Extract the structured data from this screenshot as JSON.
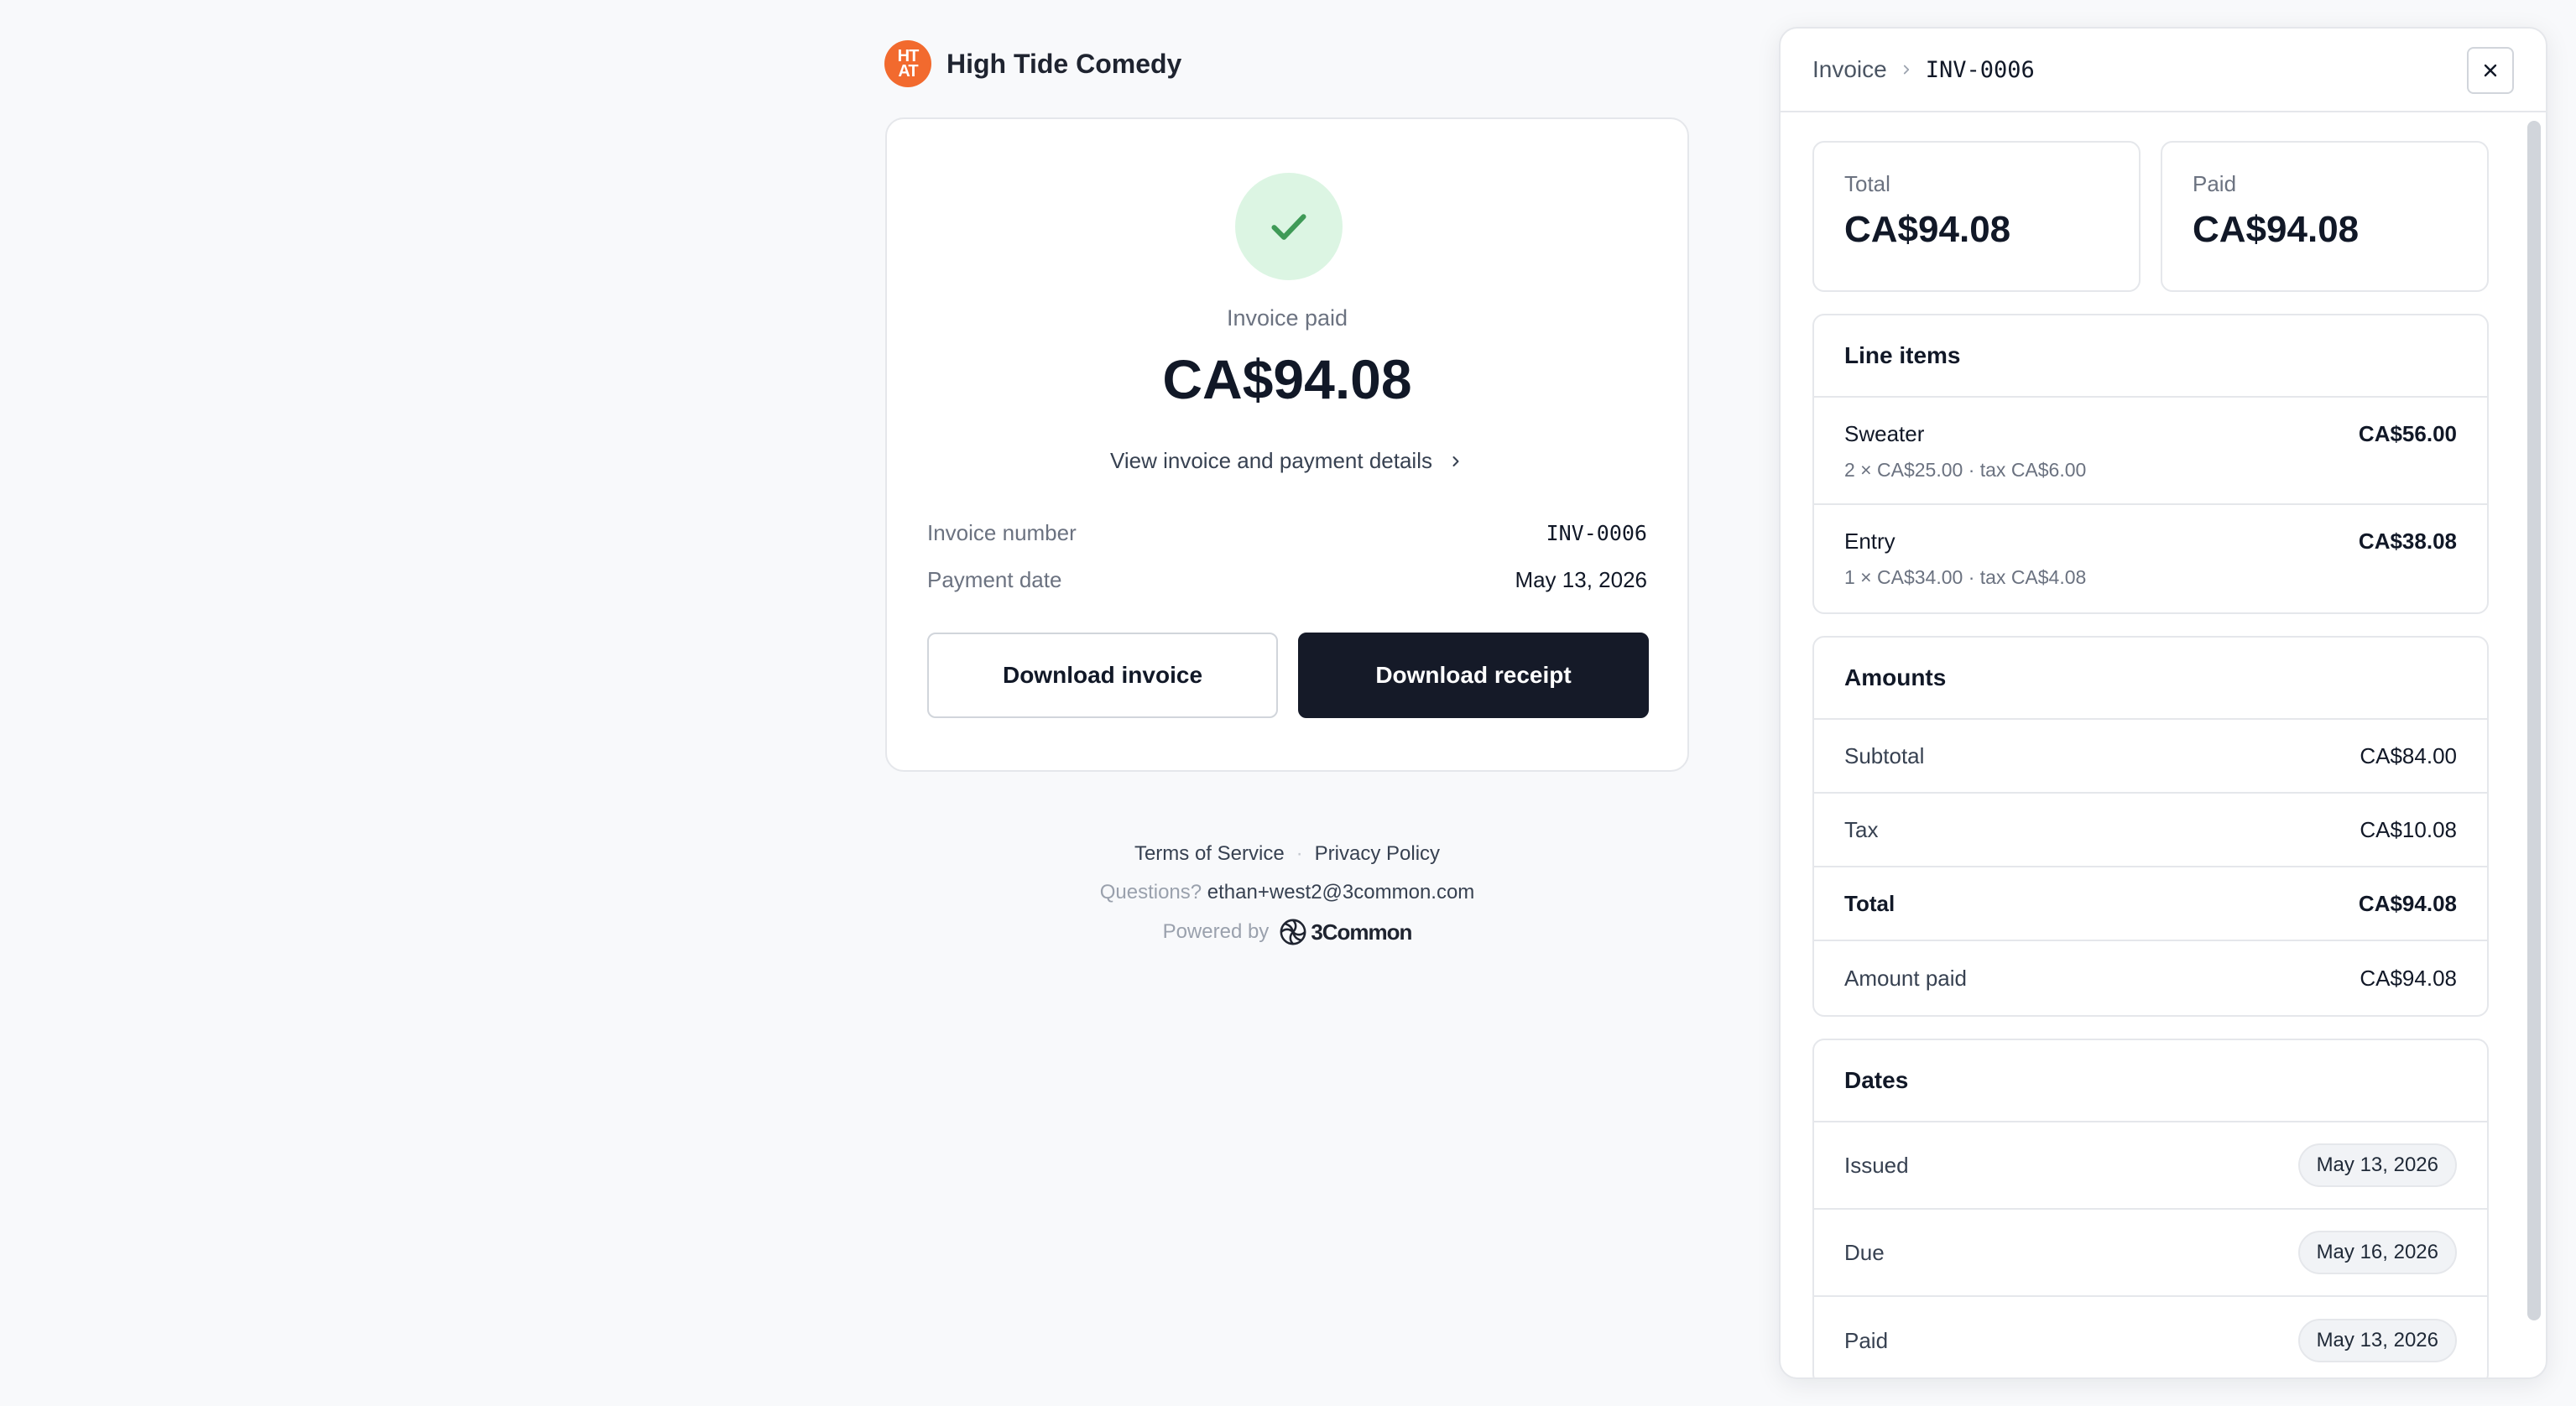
{
  "brand": {
    "name": "High Tide Comedy",
    "logo_text_top": "HT",
    "logo_text_bottom": "AT",
    "logo_color": "#f26a2e"
  },
  "receipt": {
    "status_label": "Invoice paid",
    "amount": "CA$94.08",
    "details_link": "View invoice and payment details",
    "invoice_number_label": "Invoice number",
    "invoice_number": "INV-0006",
    "payment_date_label": "Payment date",
    "payment_date": "May 13, 2026",
    "download_invoice": "Download invoice",
    "download_receipt": "Download receipt"
  },
  "footer": {
    "terms": "Terms of Service",
    "separator": "·",
    "privacy": "Privacy Policy",
    "questions_label": "Questions?",
    "email": "ethan+west2@3common.com",
    "powered_by": "Powered by",
    "powered_brand": "3Common"
  },
  "panel": {
    "breadcrumb_root": "Invoice",
    "breadcrumb_current": "INV-0006",
    "total_label": "Total",
    "total_value": "CA$94.08",
    "paid_label": "Paid",
    "paid_value": "CA$94.08",
    "line_items_title": "Line items",
    "line_items": [
      {
        "name": "Sweater",
        "detail": "2 × CA$25.00 · tax CA$6.00",
        "amount": "CA$56.00"
      },
      {
        "name": "Entry",
        "detail": "1 × CA$34.00 · tax CA$4.08",
        "amount": "CA$38.08"
      }
    ],
    "amounts_title": "Amounts",
    "amounts": [
      {
        "label": "Subtotal",
        "value": "CA$84.00"
      },
      {
        "label": "Tax",
        "value": "CA$10.08"
      },
      {
        "label": "Total",
        "value": "CA$94.08"
      },
      {
        "label": "Amount paid",
        "value": "CA$94.08"
      }
    ],
    "dates_title": "Dates",
    "dates": [
      {
        "label": "Issued",
        "value": "May 13, 2026"
      },
      {
        "label": "Due",
        "value": "May 16, 2026"
      },
      {
        "label": "Paid",
        "value": "May 13, 2026"
      }
    ]
  },
  "colors": {
    "accent_dark": "#151a28",
    "success_bg": "#dcf5e3",
    "success_check": "#3f9a57"
  },
  "icons": [
    "check-icon",
    "chevron-right-icon",
    "close-icon",
    "3common-logo-icon"
  ]
}
